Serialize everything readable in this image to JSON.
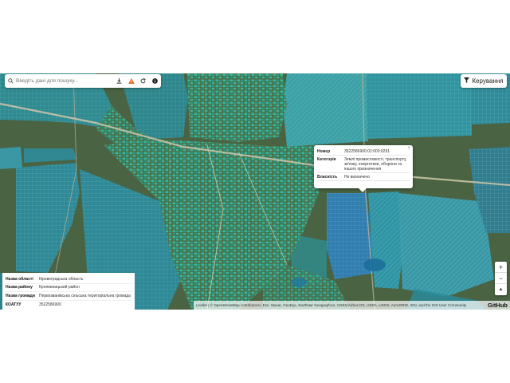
{
  "search": {
    "placeholder": "Введіть дані для пошуку..."
  },
  "toolbar": {
    "icons": [
      "search-icon",
      "download-icon",
      "warning-icon",
      "refresh-icon",
      "info-icon"
    ],
    "warning_color": "#f0642d"
  },
  "controls": {
    "manage_label": "Керування"
  },
  "popup": {
    "rows": [
      {
        "key": "Номер",
        "value": "3522586900:02:000:0291"
      },
      {
        "key": "Категорія",
        "value": "Землі промисловості, транспорту, зв'язку, енергетики, оборони та іншого призначення"
      },
      {
        "key": "Власність",
        "value": "Не визначено"
      }
    ],
    "close": "×"
  },
  "zoom": {
    "in": "+",
    "out": "−",
    "locate": "▲"
  },
  "attribution": {
    "text": "Leaflet | © OpenStreetMap contributors | Esri, Maxar, GeoEye, Earthstar Geographics, CNES/Airbus DS, USDA, USGS, AeroGRID, IGN, and the GIS User Community",
    "github": "GitHub"
  },
  "info_panel": {
    "rows": [
      {
        "key": "Назва області",
        "value": "Кіровоградська область"
      },
      {
        "key": "Назва району",
        "value": "Кропивницький район"
      },
      {
        "key": "Назва громади",
        "value": "Первозванівська сільська територіальна громада"
      },
      {
        "key": "КОАТУУ",
        "value": "3522586900"
      }
    ]
  },
  "colors": {
    "parcel_fill": "#1fb5a8",
    "parcel_stroke": "#bff2ec",
    "ground": "#3f5a3a",
    "popup_bg": "#ffffff"
  }
}
